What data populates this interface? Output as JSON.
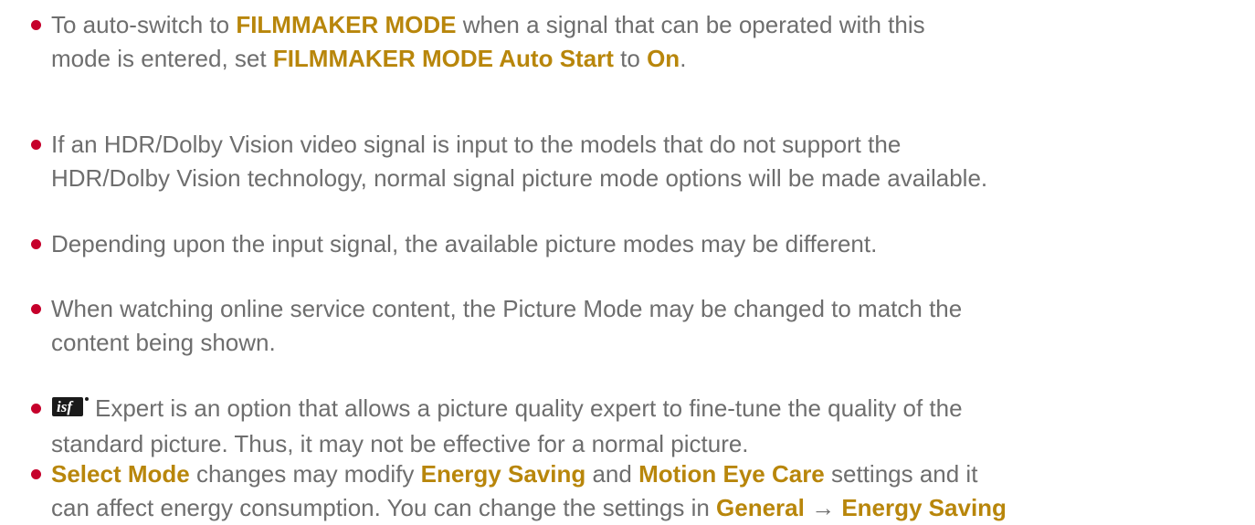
{
  "items": [
    {
      "lines": [
        [
          {
            "t": "To auto-switch to "
          },
          {
            "t": "FILMMAKER MODE",
            "b": true
          },
          {
            "t": " when a signal that can be operated with this"
          }
        ],
        [
          {
            "t": "mode is entered, set "
          },
          {
            "t": "FILMMAKER MODE Auto Start",
            "b": true
          },
          {
            "t": " to "
          },
          {
            "t": "On",
            "b": true
          },
          {
            "t": "."
          }
        ]
      ]
    },
    {
      "lines": [
        [
          {
            "t": "If an HDR/Dolby Vision video signal is input to the models that do not support the"
          }
        ],
        [
          {
            "t": "HDR/Dolby Vision technology, normal signal picture mode options will be made available."
          }
        ]
      ]
    },
    {
      "lines": [
        [
          {
            "t": "Depending upon the input signal, the available picture modes may be different."
          }
        ]
      ]
    },
    {
      "lines": [
        [
          {
            "t": "When watching online service content, the Picture Mode may be changed to match the"
          }
        ],
        [
          {
            "t": "content being shown."
          }
        ]
      ]
    },
    {
      "lines": [
        [
          {
            "icon": "isf-logo-icon",
            "logo_text": "isf"
          },
          {
            "t": "Expert is an option that allows a picture quality expert to fine-tune the quality of the"
          }
        ],
        [
          {
            "t": "standard picture. Thus, it may not be effective for a normal picture."
          }
        ]
      ]
    },
    {
      "lines": [
        [
          {
            "t": "Select Mode",
            "b": true
          },
          {
            "t": " changes may modify "
          },
          {
            "t": "Energy Saving",
            "b": true
          },
          {
            "t": " and "
          },
          {
            "t": "Motion Eye Care",
            "b": true
          },
          {
            "t": " settings and it"
          }
        ],
        [
          {
            "t": "can affect energy consumption. You can change the settings in "
          },
          {
            "t": "General",
            "b": true
          },
          {
            "t": " → ",
            "arrow": true
          },
          {
            "t": "Energy Saving",
            "b": true
          }
        ]
      ]
    }
  ],
  "colors": {
    "text": "#6e6e6e",
    "highlight": "#b8860b",
    "bullet": "#c6002b"
  }
}
